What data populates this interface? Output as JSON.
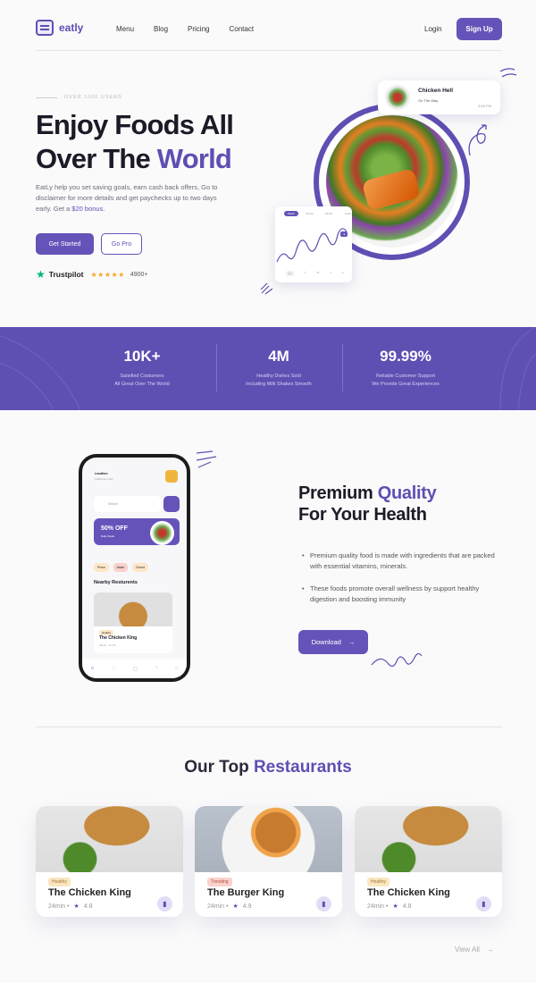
{
  "brand": "eatly",
  "nav": {
    "items": [
      "Menu",
      "Blog",
      "Pricing",
      "Contact"
    ],
    "login": "Login",
    "signup": "Sign Up"
  },
  "hero": {
    "eyebrow": "OVER 1000 USERS",
    "title_a": "Enjoy Foods All",
    "title_b": "Over The ",
    "title_accent": "World",
    "lead": "EatLy help you set saving goals, earn cash back offers, Go to disclaimer for more details and get paychecks up to two days early. Get a ",
    "lead_accent": "$20 bonus",
    "lead_end": ".",
    "btn_primary": "Get Started",
    "btn_secondary": "Go Pro",
    "trustpilot": "Trustpilot",
    "rating_stars": 5,
    "rating_count": "4900+"
  },
  "order_card": {
    "title": "Chicken Hell",
    "status": "On The Way",
    "time": "3:09 PM"
  },
  "mini_graph": {
    "tabs": [
      "Week",
      "Month",
      "Month",
      "Yearly"
    ],
    "days": [
      "M",
      "T",
      "W",
      "T",
      "F"
    ]
  },
  "stats": [
    {
      "value": "10K+",
      "line1": "Satisfied Costumers",
      "line2": "All Great Over The World"
    },
    {
      "value": "4M",
      "line1": "Healthy Dishes Sold",
      "line2": "Including Milk Shakes Smooth"
    },
    {
      "value": "99.99%",
      "line1": "Reliable Customer Support",
      "line2": "We Provide Great Experiences"
    }
  ],
  "phone": {
    "location": "Location",
    "address": "California, USA",
    "search": "Search",
    "promo_title": "50% OFF",
    "promo_sub": "Daily Deals",
    "chips": [
      "Pizza",
      "Asian",
      "Donut"
    ],
    "nearby": "Nearby Resturents",
    "card_tag": "Healthy",
    "card_title": "The Chicken King",
    "card_meta": "24min • ★ 4.8"
  },
  "premium": {
    "title_accent": "Quality",
    "title_a": "Premium ",
    "title_b": "For Your Health",
    "bullets": [
      "Premium quality food is made with ingredients that are packed with essential vitamins, minerals.",
      "These foods promote overall wellness by support healthy digestion and boosting immunity"
    ],
    "download": "Download"
  },
  "restaurants": {
    "title_a": "Our Top ",
    "title_accent": "Restaurants",
    "cards": [
      {
        "tag": "Healthy",
        "name": "The Chicken King",
        "time": "24min •",
        "rating": "4.8"
      },
      {
        "tag": "Trending",
        "name": "The Burger King",
        "time": "24min •",
        "rating": "4.9"
      },
      {
        "tag": "Healthy",
        "name": "The Chicken King",
        "time": "24min •",
        "rating": "4.8"
      }
    ],
    "view_all": "View All"
  },
  "colors": {
    "accent": "#5e4fb3",
    "button": "#6653b9",
    "trustpilot": "#00b67a",
    "stars": "#f5a623"
  }
}
